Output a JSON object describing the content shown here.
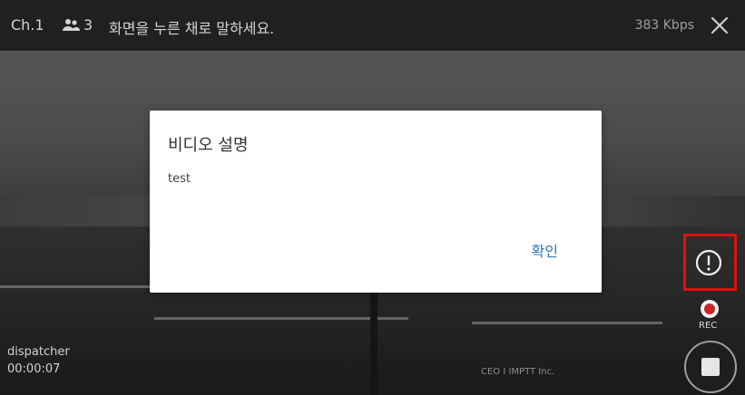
{
  "topbar": {
    "channel": "Ch.1",
    "user_count": "3",
    "hint": "화면을 누른 채로 말하세요.",
    "bitrate": "383 Kbps",
    "close_icon": "close-icon"
  },
  "dialog": {
    "title": "비디오 설명",
    "message": "test",
    "ok_label": "확인"
  },
  "controls": {
    "rec_label": "REC",
    "info_icon": "info-icon",
    "record_icon": "record-icon",
    "stop_icon": "stop-icon"
  },
  "status": {
    "user": "dispatcher",
    "time": "00:00:07"
  },
  "watermark": "CEO I IMPTT Inc.",
  "colors": {
    "topbar_bg": "#202020",
    "dialog_button": "#2e77b7",
    "highlight_border": "#e01010",
    "record_red": "#c62828"
  }
}
